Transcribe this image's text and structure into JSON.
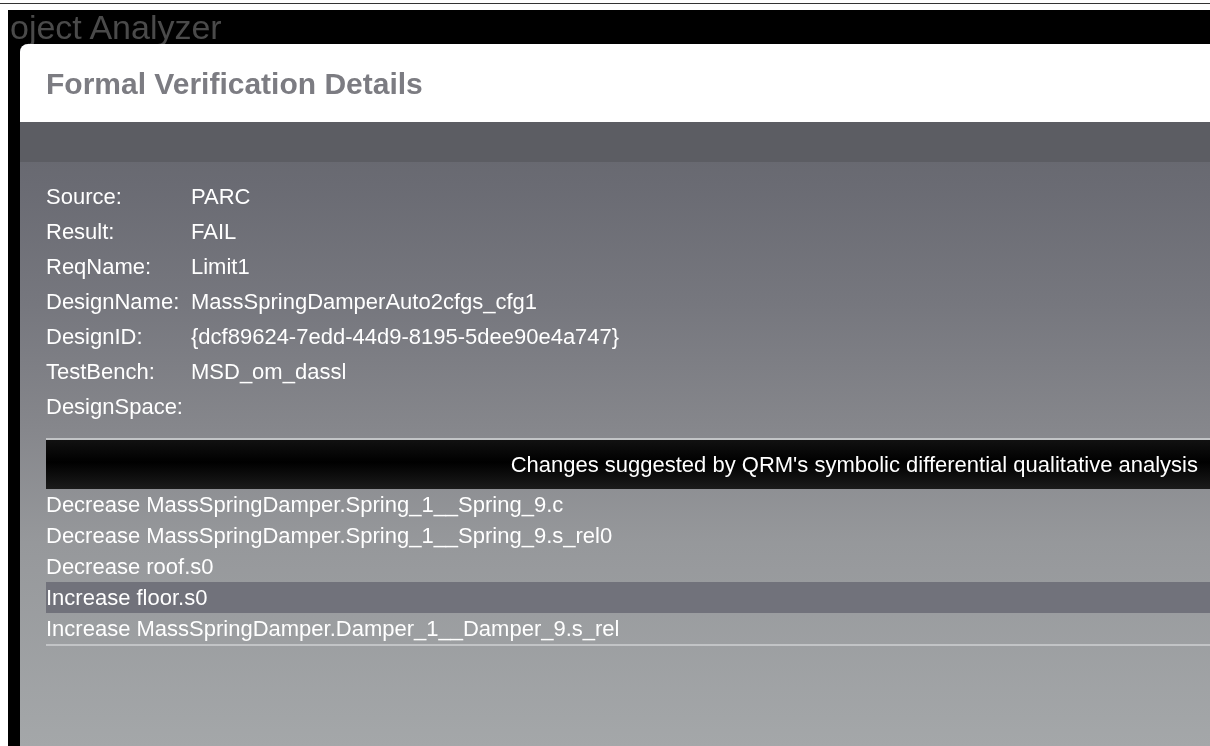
{
  "app_title": "oject Analyzer",
  "dialog": {
    "title": "Formal Verification Details"
  },
  "details": [
    {
      "label": "Source:",
      "value": "PARC"
    },
    {
      "label": "Result:",
      "value": "FAIL"
    },
    {
      "label": "ReqName:",
      "value": "Limit1"
    },
    {
      "label": "DesignName:",
      "value": "MassSpringDamperAuto2cfgs_cfg1"
    },
    {
      "label": "DesignID:",
      "value": "{dcf89624-7edd-44d9-8195-5dee90e4a747}"
    },
    {
      "label": "TestBench:",
      "value": "MSD_om_dassl"
    },
    {
      "label": "DesignSpace:"
    }
  ],
  "table": {
    "column_header": "Changes suggested by QRM's symbolic differential qualitative analysis",
    "rows": [
      {
        "text": "Decrease MassSpringDamper.Spring_1__Spring_9.c",
        "selected": false
      },
      {
        "text": "Decrease MassSpringDamper.Spring_1__Spring_9.s_rel0",
        "selected": false
      },
      {
        "text": "Decrease roof.s0",
        "selected": false
      },
      {
        "text": "Increase floor.s0",
        "selected": true
      },
      {
        "text": "Increase MassSpringDamper.Damper_1__Damper_9.s_rel",
        "selected": false
      }
    ]
  }
}
